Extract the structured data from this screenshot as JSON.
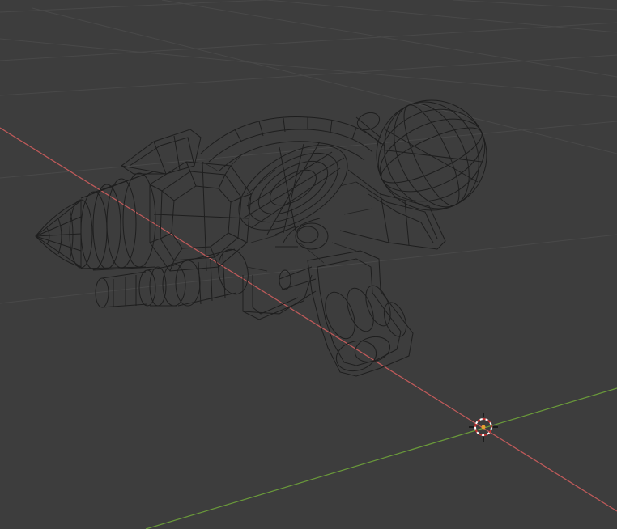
{
  "viewport": {
    "background_color": "#3d3d3d",
    "grid_color": "#494949",
    "x_axis_color": "#c05a5a",
    "y_axis_color": "#6a9a3a",
    "wireframe_color": "#1e1e1e",
    "shading_mode": "wireframe",
    "object": "ray-gun-mesh",
    "cursor_icon": "3d-cursor-icon"
  }
}
